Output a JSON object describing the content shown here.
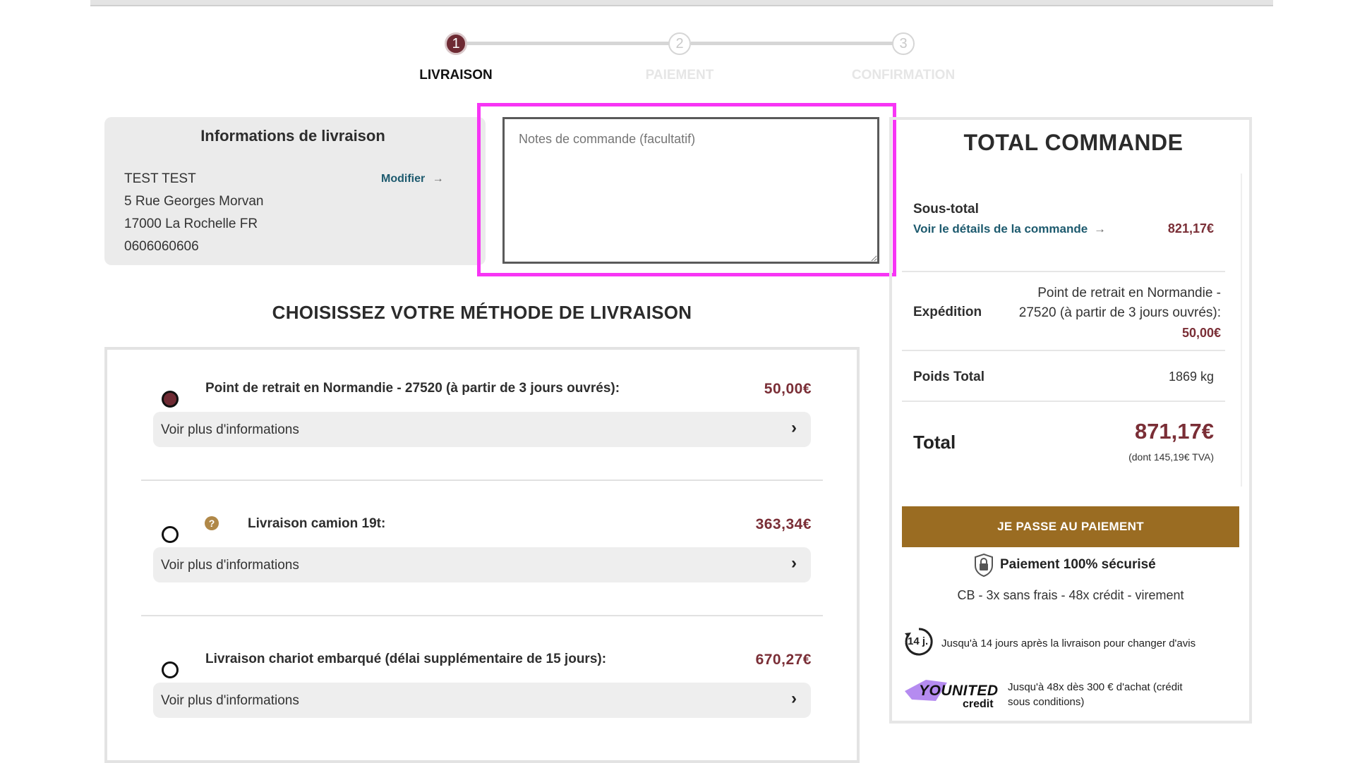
{
  "stepper": {
    "steps": [
      {
        "number": "1",
        "label": "LIVRAISON",
        "active": true
      },
      {
        "number": "2",
        "label": "PAIEMENT",
        "active": false
      },
      {
        "number": "3",
        "label": "CONFIRMATION",
        "active": false
      }
    ]
  },
  "delivery_info": {
    "title": "Informations de livraison",
    "edit_link": "Modifier",
    "edit_arrow": "→",
    "name": "TEST TEST",
    "street": "5 Rue Georges Morvan",
    "city": "17000 La Rochelle FR",
    "phone": "0606060606"
  },
  "order_notes": {
    "placeholder": "Notes de commande (facultatif)",
    "value": ""
  },
  "shipping": {
    "title": "CHOISISSEZ VOTRE MÉTHODE DE LIVRAISON",
    "more_info_label": "Voir plus d'informations",
    "chevron": "›",
    "help_glyph": "?",
    "methods": [
      {
        "label": "Point de retrait en Normandie - 27520 (à partir de 3 jours ouvrés):",
        "price": "50,00€",
        "selected": true
      },
      {
        "label": "Livraison camion 19t:",
        "price": "363,34€",
        "selected": false
      },
      {
        "label": "Livraison chariot embarqué (délai supplémentaire de 15 jours):",
        "price": "670,27€",
        "selected": false
      }
    ]
  },
  "summary": {
    "title": "TOTAL COMMANDE",
    "subtotal_label": "Sous-total",
    "details_link": "Voir le détails de la commande",
    "details_arrow": "→",
    "subtotal_value": "821,17€",
    "shipping_label": "Expédition",
    "shipping_desc_line1": "Point de retrait en Normandie -",
    "shipping_desc_line2": "27520 (à partir de 3 jours ouvrés):",
    "shipping_value": "50,00€",
    "weight_label": "Poids Total",
    "weight_value": "1869 kg",
    "total_label": "Total",
    "total_value": "871,17€",
    "vat_note": "(dont 145,19€ TVA)",
    "pay_button": "JE PASSE AU PAIEMENT",
    "secure_label": "Paiement 100% sécurisé",
    "payment_methods": "CB - 3x sans frais - 48x crédit - virement",
    "return_badge": "14 j.",
    "return_policy": "Jusqu'à 14 jours après la livraison pour changer d'avis",
    "younited_word": "YOUNITED",
    "younited_sub": "credit",
    "credit_line1": "Jusqu'à 48x dès 300 € d'achat (crédit",
    "credit_line2": "sous conditions)"
  },
  "colors": {
    "maroon": "#6e2a33",
    "price_maroon": "#7a2e36",
    "teal_link": "#1d5a6e",
    "gold_button": "#9a6c22",
    "highlight": "#f735f5",
    "younited_purple": "#b58bf0"
  }
}
